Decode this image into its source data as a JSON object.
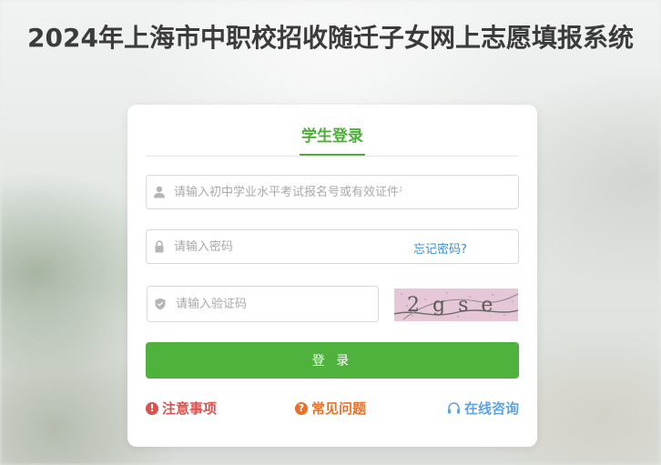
{
  "page": {
    "title": "2024年上海市中职校招收随迁子女网上志愿填报系统"
  },
  "login": {
    "tab_label": "学生登录",
    "username_placeholder": "请输入初中学业水平考试报名号或有效证件号",
    "password_placeholder": "请输入密码",
    "forgot_password": "忘记密码?",
    "captcha_placeholder": "请输入验证码",
    "submit_label": "登 录"
  },
  "captcha": {
    "text": "2gse"
  },
  "links": {
    "notice": "注意事项",
    "faq": "常见问题",
    "consult": "在线咨询"
  },
  "icons": {
    "username": "user-icon",
    "password": "lock-icon",
    "captcha": "shield-icon",
    "notice": "exclamation-icon",
    "faq": "question-icon",
    "consult": "headset-icon"
  },
  "colors": {
    "accent": "#4fb23c",
    "link_blue": "#3d8fd9",
    "notice_red": "#d9534f",
    "faq_orange": "#e9702a",
    "consult_blue": "#5fa2e0"
  }
}
